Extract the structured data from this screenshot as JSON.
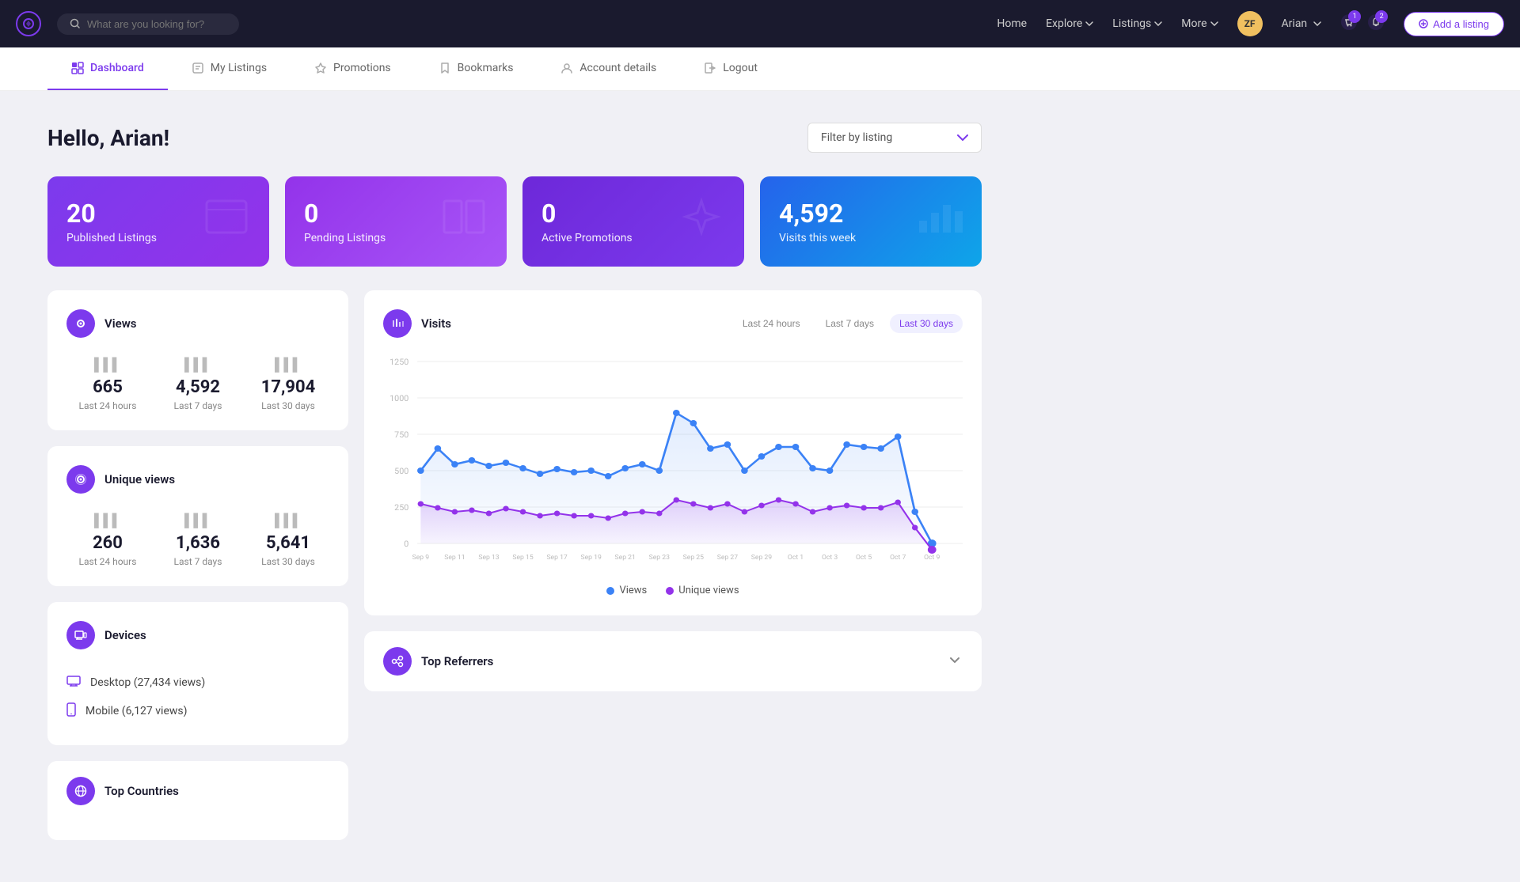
{
  "nav": {
    "logo_text": "✦",
    "search_placeholder": "What are you looking for?",
    "links": [
      {
        "label": "Home",
        "has_dropdown": false
      },
      {
        "label": "Explore",
        "has_dropdown": true
      },
      {
        "label": "Listings",
        "has_dropdown": true
      },
      {
        "label": "More",
        "has_dropdown": true
      }
    ],
    "user_name": "Arian",
    "user_initials": "ZF",
    "add_listing_label": "Add a listing"
  },
  "sub_nav": {
    "items": [
      {
        "label": "Dashboard",
        "icon": "dashboard",
        "active": true
      },
      {
        "label": "My Listings",
        "icon": "listings",
        "active": false
      },
      {
        "label": "Promotions",
        "icon": "promotions",
        "active": false
      },
      {
        "label": "Bookmarks",
        "icon": "bookmarks",
        "active": false
      },
      {
        "label": "Account details",
        "icon": "account",
        "active": false
      },
      {
        "label": "Logout",
        "icon": "logout",
        "active": false
      }
    ]
  },
  "page": {
    "title": "Hello, Arian!",
    "filter_label": "Filter by listing",
    "filter_placeholder": "Filter by listing"
  },
  "stat_cards": [
    {
      "number": "20",
      "label": "Published Listings",
      "color": "card-purple",
      "icon": "⬜"
    },
    {
      "number": "0",
      "label": "Pending Listings",
      "color": "card-violet",
      "icon": "▤"
    },
    {
      "number": "0",
      "label": "Active Promotions",
      "color": "card-dark-purple",
      "icon": "⚡"
    },
    {
      "number": "4,592",
      "label": "Visits this week",
      "color": "card-blue",
      "icon": "📊"
    }
  ],
  "views_widget": {
    "title": "Views",
    "stats": [
      {
        "value": "665",
        "label": "Last 24 hours"
      },
      {
        "value": "4,592",
        "label": "Last 7 days"
      },
      {
        "value": "17,904",
        "label": "Last 30 days"
      }
    ]
  },
  "unique_views_widget": {
    "title": "Unique views",
    "stats": [
      {
        "value": "260",
        "label": "Last 24 hours"
      },
      {
        "value": "1,636",
        "label": "Last 7 days"
      },
      {
        "value": "5,641",
        "label": "Last 30 days"
      }
    ]
  },
  "devices_widget": {
    "title": "Devices",
    "items": [
      {
        "label": "Desktop (27,434 views)",
        "icon": "💻"
      },
      {
        "label": "Mobile (6,127 views)",
        "icon": "📱"
      }
    ]
  },
  "top_countries_widget": {
    "title": "Top Countries"
  },
  "visits_chart": {
    "title": "Visits",
    "time_filters": [
      "Last 24 hours",
      "Last 7 days",
      "Last 30 days"
    ],
    "active_filter": "Last 30 days",
    "y_labels": [
      "0",
      "250",
      "500",
      "750",
      "1000",
      "1250"
    ],
    "legend": [
      {
        "label": "Views",
        "color": "#3b82f6"
      },
      {
        "label": "Unique views",
        "color": "#9333ea"
      }
    ]
  },
  "top_referrers": {
    "title": "Top Referrers"
  }
}
